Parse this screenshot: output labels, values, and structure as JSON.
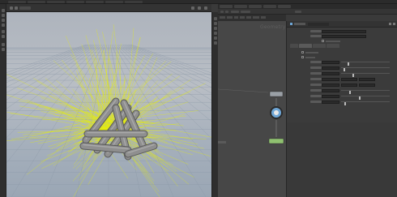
{
  "app": {
    "name": "Houdini"
  },
  "network": {
    "context_label": "Geometry"
  },
  "colors": {
    "hair_yellow": "#e8f000",
    "log_grey": "#8f8f8f",
    "node_grey": "#9aa0a6",
    "node_blue": "#6ea6d6",
    "node_green": "#8fc070",
    "panel_bg": "#3b3b3b",
    "network_bg": "#474747"
  },
  "icons": [
    "select-tool-icon",
    "move-tool-icon",
    "rotate-tool-icon",
    "scale-tool-icon",
    "handle-tool-icon",
    "brush-tool-icon",
    "camera-icon",
    "light-icon",
    "wireframe-icon",
    "shaded-icon",
    "display-options-icon"
  ]
}
